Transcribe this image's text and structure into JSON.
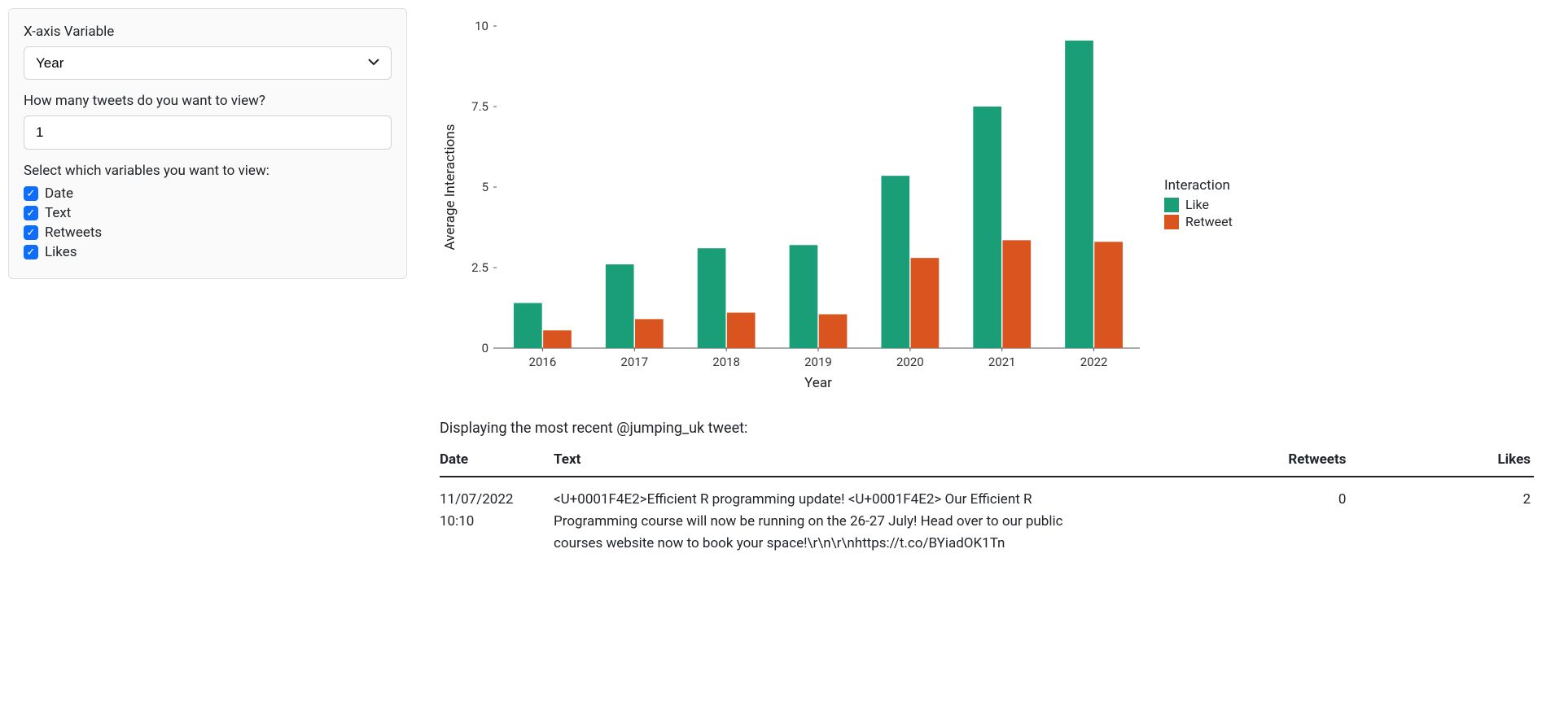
{
  "sidebar": {
    "xaxis_label": "X-axis Variable",
    "xaxis_value": "Year",
    "count_label": "How many tweets do you want to view?",
    "count_value": "1",
    "vars_label": "Select which variables you want to view:",
    "checkboxes": [
      {
        "label": "Date"
      },
      {
        "label": "Text"
      },
      {
        "label": "Retweets"
      },
      {
        "label": "Likes"
      }
    ]
  },
  "chart_data": {
    "type": "bar",
    "categories": [
      "2016",
      "2017",
      "2018",
      "2019",
      "2020",
      "2021",
      "2022"
    ],
    "series": [
      {
        "name": "Like",
        "values": [
          1.4,
          2.6,
          3.1,
          3.2,
          5.35,
          7.5,
          9.55
        ],
        "color": "#1a9e78"
      },
      {
        "name": "Retweet",
        "values": [
          0.55,
          0.9,
          1.1,
          1.05,
          2.8,
          3.35,
          3.3
        ],
        "color": "#d9541f"
      }
    ],
    "xlabel": "Year",
    "ylabel": "Average Interactions",
    "ylim": [
      0,
      10
    ],
    "yticks": [
      0,
      2.5,
      5,
      7.5,
      10
    ],
    "legend_title": "Interaction"
  },
  "result": {
    "caption": "Displaying the most recent @jumping_uk tweet:",
    "headers": [
      "Date",
      "Text",
      "Retweets",
      "Likes"
    ],
    "rows": [
      {
        "date": "11/07/2022 10:10",
        "text": "<U+0001F4E2>Efficient R programming update! <U+0001F4E2> Our Efficient R Programming course will now be running on the 26-27 July! Head over to our public courses website now to book your space!\\r\\n\\r\\nhttps://t.co/BYiadOK1Tn",
        "retweets": "0",
        "likes": "2"
      }
    ]
  }
}
